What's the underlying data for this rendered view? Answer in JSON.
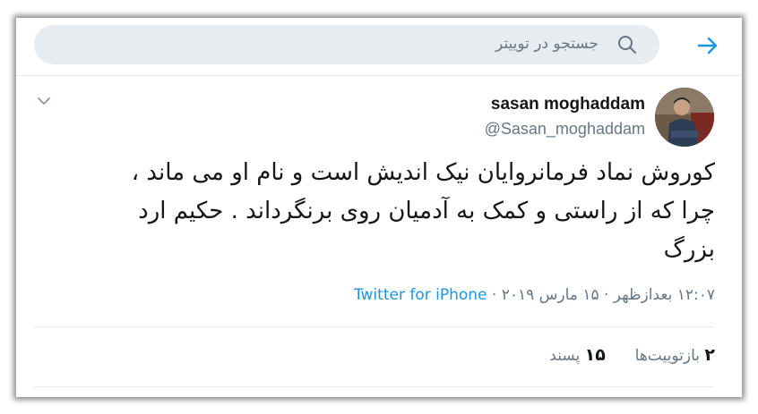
{
  "search": {
    "placeholder": "جستجو در توییتر"
  },
  "tweet": {
    "author": {
      "display_name": "sasan moghaddam",
      "handle": "@Sasan_moghaddam"
    },
    "text_lines": [
      "کوروش نماد فرمانروایان نیک اندیش است و نام او می ماند ،",
      "چرا که از راستی و کمک به آدمیان روی برنگرداند . حکیم ارد",
      "بزرگ"
    ],
    "timestamp": "۱۲:۰۷ بعدازظهر · ۱۵ مارس ۲۰۱۹ · ",
    "source": "Twitter for iPhone"
  },
  "stats": {
    "retweets_count": "۲",
    "retweets_label": "بازتوییت‌ها",
    "likes_count": "۱۵",
    "likes_label": "پسند"
  },
  "icons": {
    "back": "arrow-right-icon",
    "search": "search-icon",
    "caret": "chevron-down-icon"
  },
  "colors": {
    "accent": "#1b95e0",
    "muted": "#657786",
    "search_bg": "#e6ecf0"
  }
}
